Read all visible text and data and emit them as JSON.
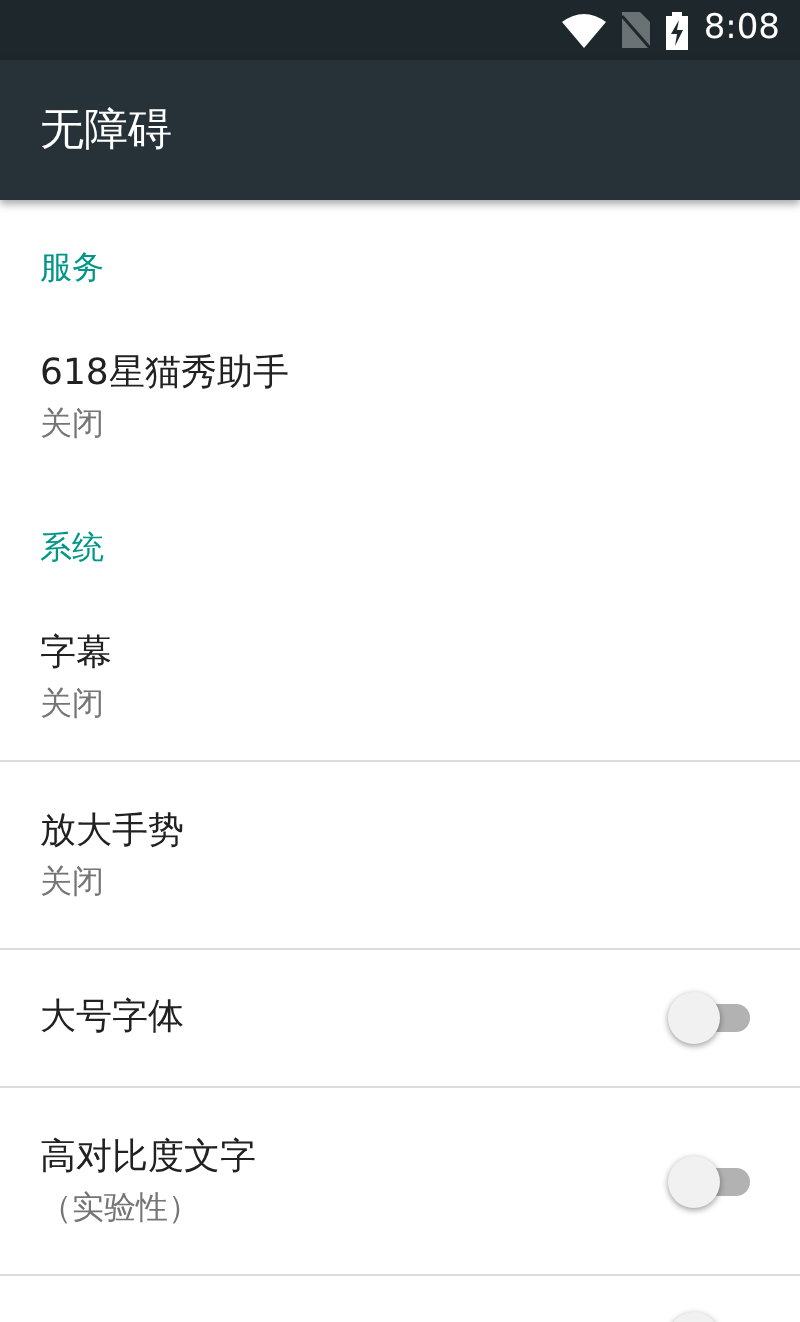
{
  "status_bar": {
    "time": "8:08"
  },
  "app_bar": {
    "title": "无障碍"
  },
  "sections": [
    {
      "header": "服务",
      "items": [
        {
          "kind": "text",
          "title": "618星猫秀助手",
          "summary": "关闭"
        }
      ]
    },
    {
      "header": "系统",
      "items": [
        {
          "kind": "text",
          "title": "字幕",
          "summary": "关闭"
        },
        {
          "kind": "text",
          "title": "放大手势",
          "summary": "关闭"
        },
        {
          "kind": "switch",
          "title": "大号字体",
          "on": false
        },
        {
          "kind": "switch",
          "title": "高对比度文字",
          "summary": "（实验性）",
          "on": false
        },
        {
          "kind": "switch",
          "on": false
        }
      ]
    }
  ]
}
